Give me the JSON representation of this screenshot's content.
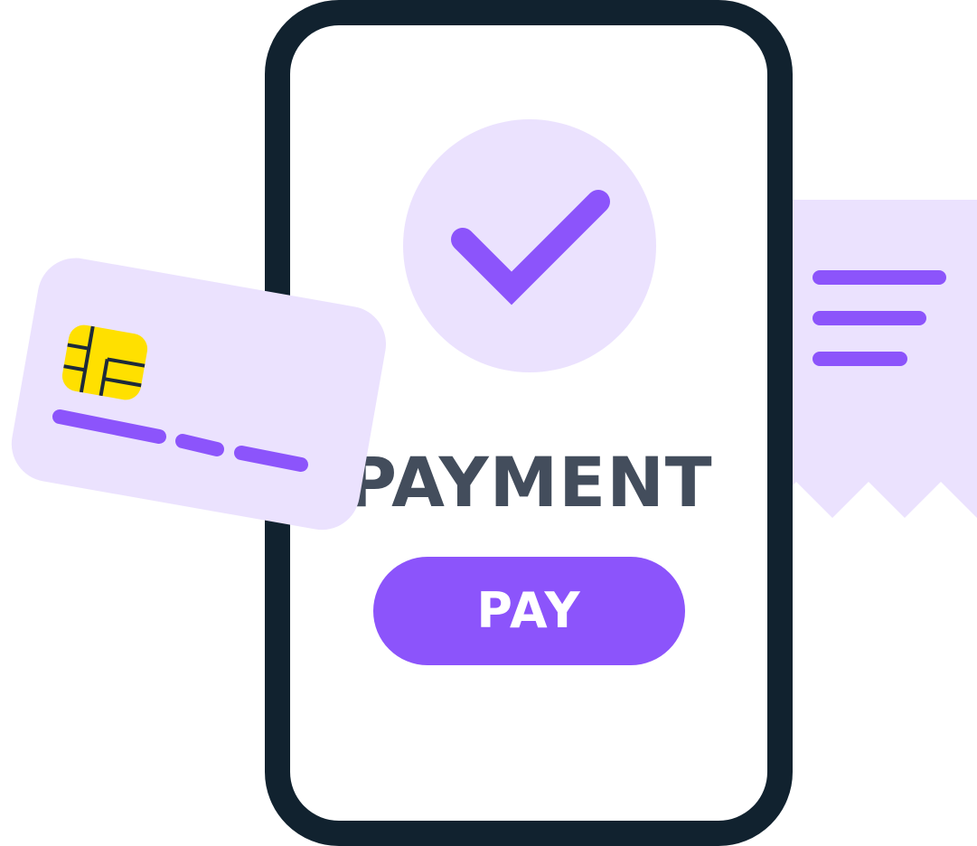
{
  "screen": {
    "title": "PAYMENT",
    "pay_button_label": "PAY"
  },
  "icons": {
    "status": "checkmark-icon",
    "card": "credit-card-icon",
    "receipt": "receipt-icon"
  },
  "colors": {
    "accent": "#8c54fb",
    "light_accent": "#ebe2fe",
    "phone_frame": "#11222f",
    "title_text": "#434d5c",
    "chip": "#ffe000"
  }
}
